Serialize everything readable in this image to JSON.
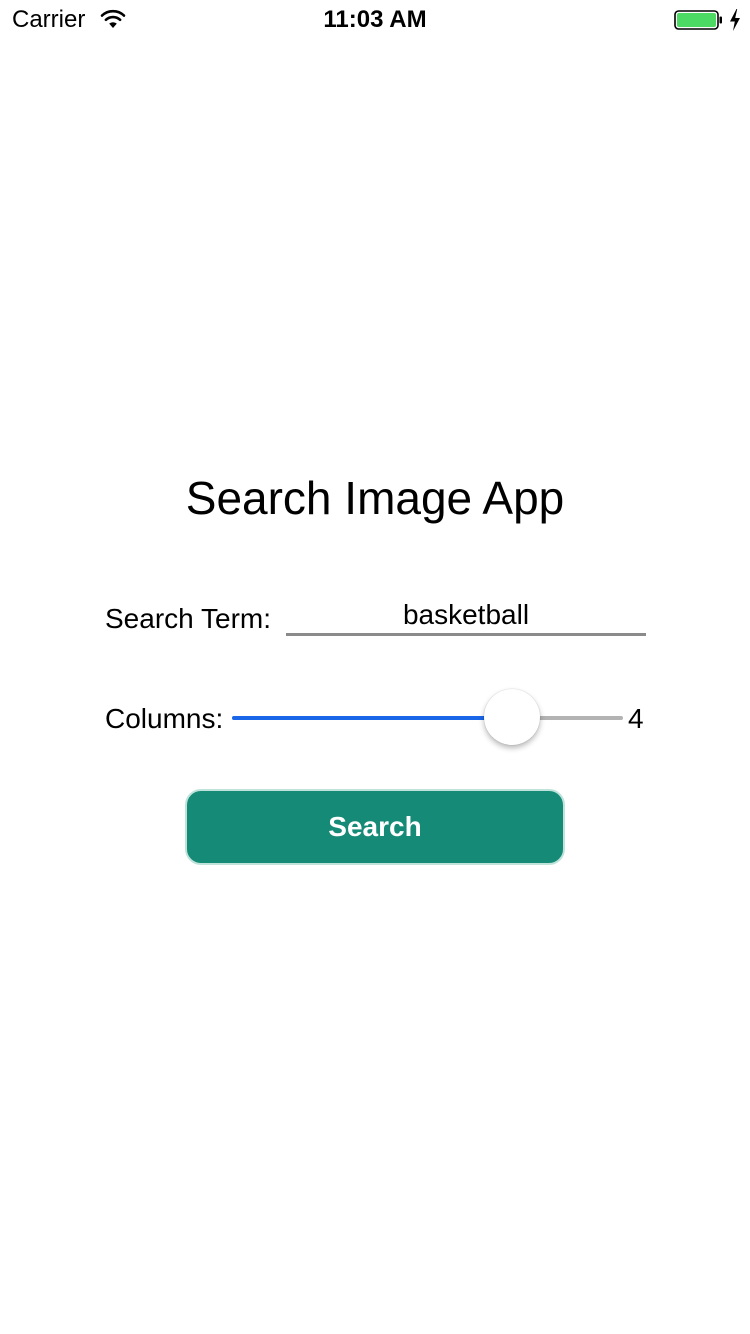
{
  "status_bar": {
    "carrier": "Carrier",
    "time": "11:03 AM",
    "battery_color": "#4cd964"
  },
  "title": "Search Image App",
  "search": {
    "label": "Search Term:",
    "value": "basketball"
  },
  "columns": {
    "label": "Columns:",
    "value": "4",
    "slider_fraction": 0.715,
    "fill_color": "#1a66e8"
  },
  "button": {
    "label": "Search",
    "color": "#148a77"
  }
}
